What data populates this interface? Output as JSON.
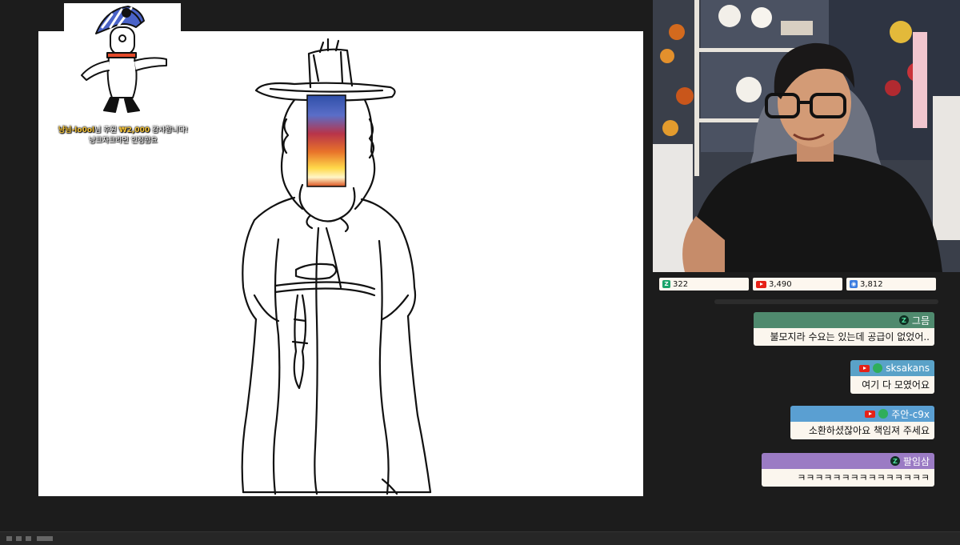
{
  "donation": {
    "donor": "냥님-lo0ol",
    "suffix": "님 후원",
    "amount": "₩2,000",
    "thanks": " 감사합니다!",
    "message": "냥크자크라면 인정함요"
  },
  "stats": [
    {
      "icon": "chzzk-icon",
      "value": "322",
      "color": "#1aa46a"
    },
    {
      "icon": "youtube-icon",
      "value": "3,490",
      "color": "#e62117"
    },
    {
      "icon": "viewer-icon",
      "value": "3,812",
      "color": "#3b7de0"
    }
  ],
  "chat": [
    {
      "user": "그믐",
      "text": "불모지라 수요는 있는데 공급이 없었어..",
      "platform": "chzzk",
      "color": "#4f8a6e"
    },
    {
      "user": "sksakans",
      "text": "여기 다 모였어요",
      "platform": "youtube",
      "color": "#5aa2c8"
    },
    {
      "user": "주안-c9x",
      "text": "소환하셨잖아요 책임져 주세요",
      "platform": "youtube",
      "color": "#5a9fd2"
    },
    {
      "user": "팔임삼",
      "text": "ㅋㅋㅋㅋㅋㅋㅋㅋㅋㅋㅋㅋㅋㅋㅋ",
      "platform": "chzzk",
      "color": "#9b7bc4"
    }
  ]
}
